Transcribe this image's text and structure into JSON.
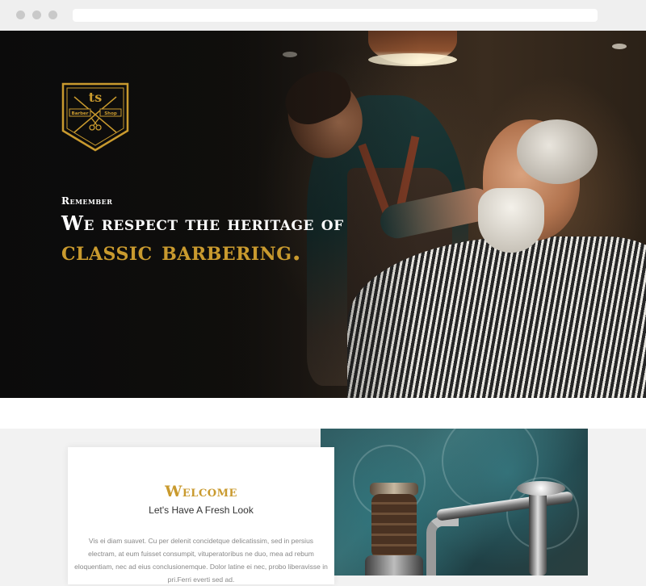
{
  "hero": {
    "eyebrow": "Remember",
    "headline_line1": "We respect the heritage of",
    "headline_line2": "classic barbering.",
    "logo": {
      "icon": "barber-shop-badge-icon",
      "lettering": [
        "Barber",
        "Shop"
      ],
      "color": "#c99a2e"
    }
  },
  "about": {
    "title": "Welcome",
    "subtitle": "Let's Have A Fresh Look",
    "body": "Vis ei diam suavet. Cu per delenit concidetque delicatissim, sed in persius electram, at eum fuisset consumpit, vituperatoribus ne duo, mea ad rebum eloquentiam, nec ad eius conclusionemque. Dolor latine ei nec, probo liberavisse in pri.Ferri everti sed ad."
  },
  "colors": {
    "accent": "#c99a2e",
    "hero_text": "#ffffff",
    "page_bg": "#f2f2f2"
  }
}
